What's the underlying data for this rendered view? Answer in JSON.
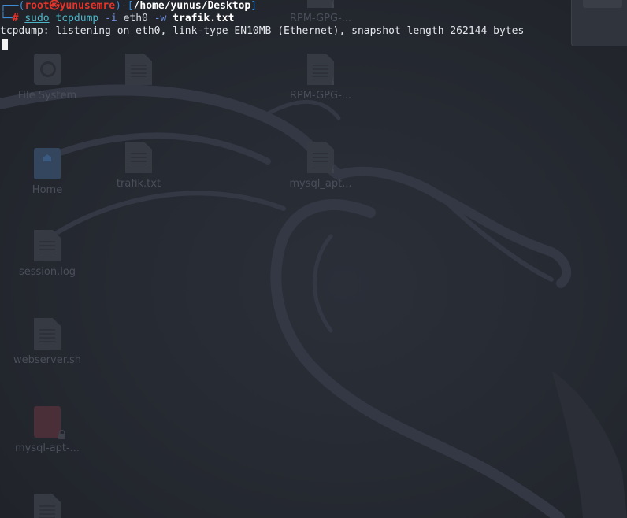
{
  "desktop": {
    "icons": [
      {
        "label": "File System",
        "icon": "drive-icon"
      },
      {
        "label": "Home",
        "icon": "home-folder-icon"
      },
      {
        "label": "session.log",
        "icon": "file-icon"
      },
      {
        "label": "webserver.sh",
        "icon": "script-file-icon"
      },
      {
        "label": "mysql-apt-...",
        "icon": "locked-package-icon"
      },
      {
        "label": "trafik.txt",
        "icon": "text-file-icon"
      },
      {
        "label": "RPM-GPG-...",
        "icon": "locked-file-icon"
      },
      {
        "label": "RPM-GPG-...",
        "icon": "locked-file-icon"
      },
      {
        "label": "mysql_apt...",
        "icon": "locked-file-icon"
      }
    ]
  },
  "terminal": {
    "prompt": {
      "frame_top": "┌──(",
      "user": "root㉿yunusemre",
      "sep": ")-[",
      "path": "/home/yunus/Desktop",
      "close": "]",
      "frame_bottom": "└─",
      "symbol": "#"
    },
    "command": {
      "sudo": "sudo",
      "program": "tcpdump",
      "flag_i": "-i",
      "iface": "eth0",
      "flag_w": "-w",
      "file": "trafik.txt"
    },
    "output": [
      "tcpdump: listening on eth0, link-type EN10MB (Ethernet), snapshot length 262144 bytes"
    ]
  },
  "colors": {
    "prompt_frame": "#3d8cd6",
    "prompt_user": "#e5352b",
    "command": "#4fb6c9",
    "background": "#23262e"
  }
}
